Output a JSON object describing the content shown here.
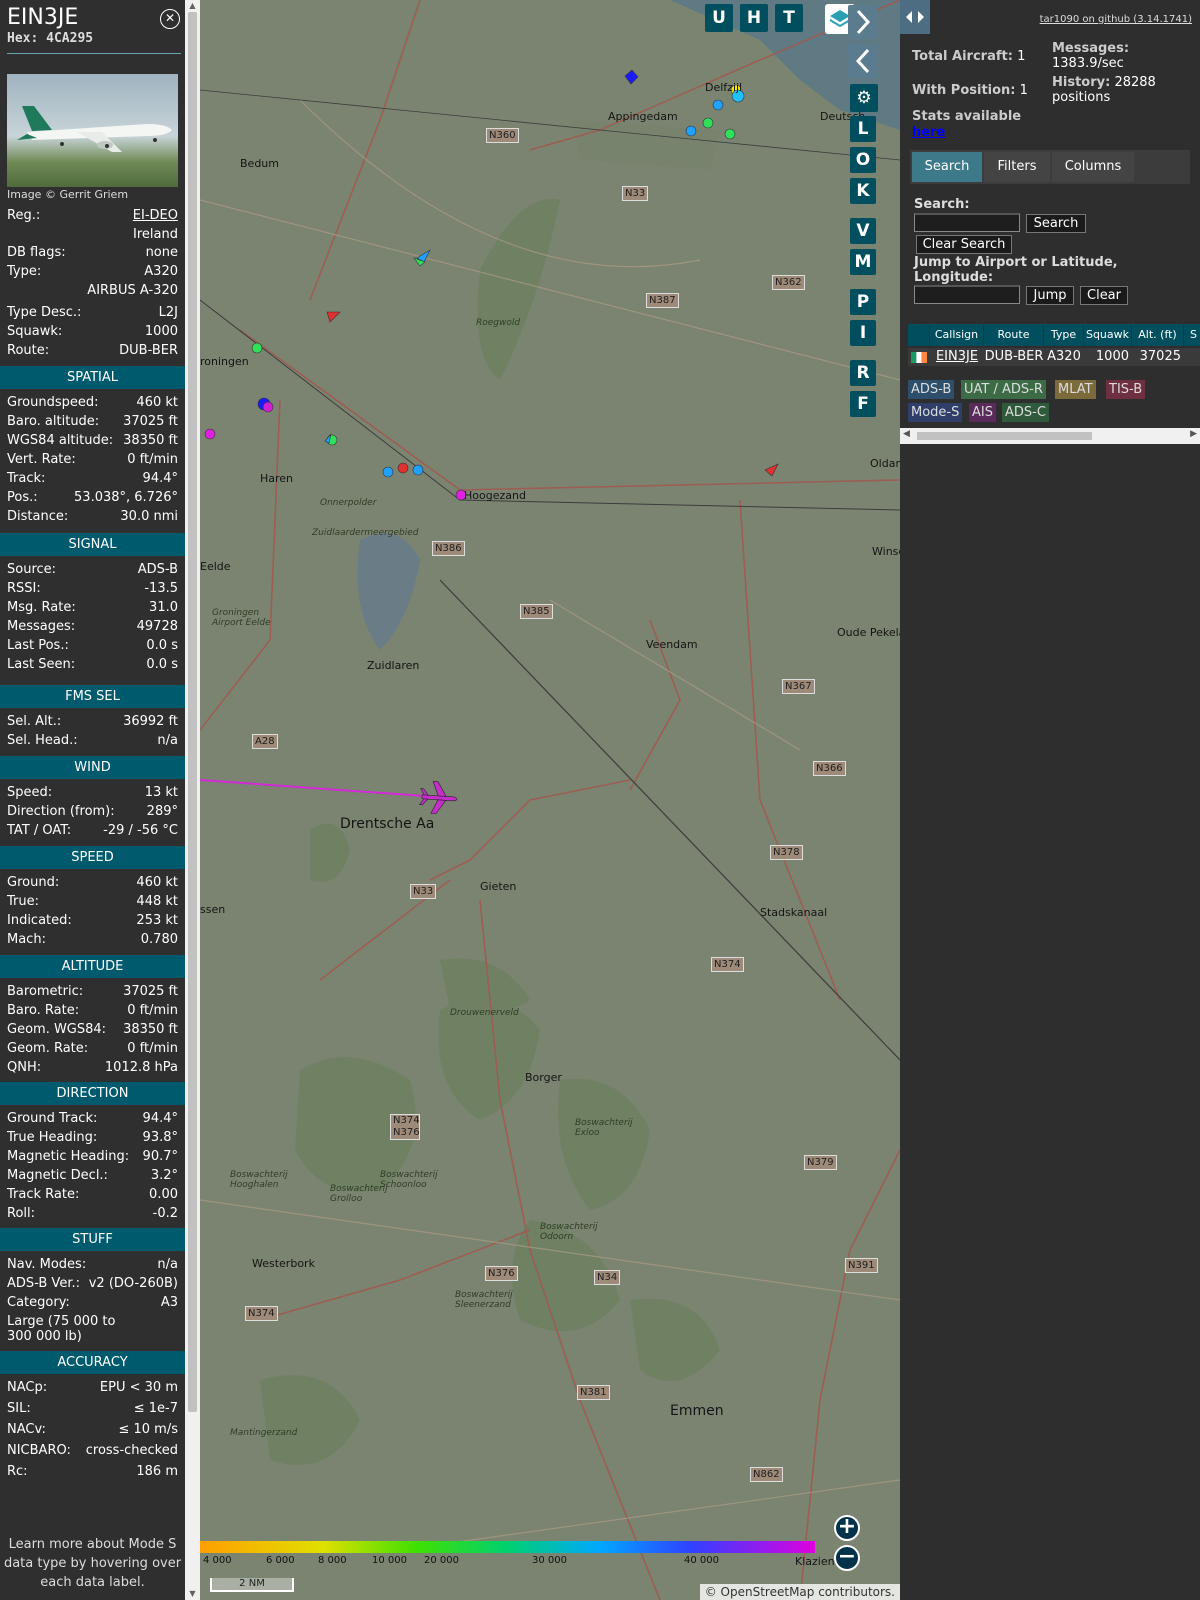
{
  "sidebar": {
    "callsign": "EIN3JE",
    "hex": "Hex: 4CA295",
    "close_icon": "close-circle-icon",
    "credit": "Image © Gerrit Griem",
    "info": [
      {
        "k": "Reg.:",
        "v": "EI-DEO",
        "link": true
      },
      {
        "k": "",
        "v": "Ireland"
      },
      {
        "k": "DB flags:",
        "v": "none"
      },
      {
        "k": "Type:",
        "v": "A320"
      },
      {
        "k": "",
        "v": "AIRBUS A-320"
      },
      {
        "k": "Type Desc.:",
        "v": "L2J"
      },
      {
        "k": "Squawk:",
        "v": "1000"
      },
      {
        "k": "Route:",
        "v": "DUB-BER"
      }
    ],
    "sections": [
      {
        "title": "SPATIAL",
        "rows": [
          {
            "k": "Groundspeed:",
            "v": "460 kt"
          },
          {
            "k": "Baro. altitude:",
            "v": "37025 ft"
          },
          {
            "k": "WGS84 altitude:",
            "v": "38350 ft"
          },
          {
            "k": "Vert. Rate:",
            "v": "0 ft/min"
          },
          {
            "k": "Track:",
            "v": "94.4°"
          },
          {
            "k": "Pos.:",
            "v": "53.038°, 6.726°"
          },
          {
            "k": "Distance:",
            "v": "30.0 nmi"
          }
        ]
      },
      {
        "title": "SIGNAL",
        "rows": [
          {
            "k": "Source:",
            "v": "ADS-B"
          },
          {
            "k": "RSSI:",
            "v": "-13.5"
          },
          {
            "k": "Msg. Rate:",
            "v": "31.0"
          },
          {
            "k": "Messages:",
            "v": "49728"
          },
          {
            "k": "Last Pos.:",
            "v": "0.0 s"
          },
          {
            "k": "Last Seen:",
            "v": "0.0 s"
          }
        ]
      },
      {
        "title": "FMS SEL",
        "rows": [
          {
            "k": "Sel. Alt.:",
            "v": "36992 ft"
          },
          {
            "k": "Sel. Head.:",
            "v": "n/a"
          }
        ]
      },
      {
        "title": "WIND",
        "rows": [
          {
            "k": "Speed:",
            "v": "13 kt"
          },
          {
            "k": "Direction (from):",
            "v": "289°"
          },
          {
            "k": "TAT / OAT:",
            "v": "-29 / -56 °C"
          }
        ]
      },
      {
        "title": "SPEED",
        "rows": [
          {
            "k": "Ground:",
            "v": "460 kt"
          },
          {
            "k": "True:",
            "v": "448 kt"
          },
          {
            "k": "Indicated:",
            "v": "253 kt"
          },
          {
            "k": "Mach:",
            "v": "0.780"
          }
        ]
      },
      {
        "title": "ALTITUDE",
        "rows": [
          {
            "k": "Barometric:",
            "v": "37025 ft"
          },
          {
            "k": "Baro. Rate:",
            "v": "0 ft/min"
          },
          {
            "k": "Geom. WGS84:",
            "v": "38350 ft"
          },
          {
            "k": "Geom. Rate:",
            "v": "0 ft/min"
          },
          {
            "k": "QNH:",
            "v": "1012.8 hPa"
          }
        ]
      },
      {
        "title": "DIRECTION",
        "rows": [
          {
            "k": "Ground Track:",
            "v": "94.4°"
          },
          {
            "k": "True Heading:",
            "v": "93.8°"
          },
          {
            "k": "Magnetic Heading:",
            "v": "90.7°"
          },
          {
            "k": "Magnetic Decl.:",
            "v": "3.2°"
          },
          {
            "k": "Track Rate:",
            "v": "0.00"
          },
          {
            "k": "Roll:",
            "v": "-0.2"
          }
        ]
      },
      {
        "title": "STUFF",
        "rows": [
          {
            "k": "Nav. Modes:",
            "v": "n/a"
          },
          {
            "k": "ADS-B Ver.:",
            "v": "v2 (DO-260B)"
          },
          {
            "k": "Category:",
            "v": "A3"
          },
          {
            "k": "Large (75 000 to 300 000 lb)",
            "v": ""
          }
        ]
      },
      {
        "title": "ACCURACY",
        "rows": [
          {
            "k": "NACp:",
            "v": "EPU < 30 m"
          },
          {
            "k": "SIL:",
            "v": "≤ 1e-7"
          },
          {
            "k": "NACv:",
            "v": "≤ 10 m/s"
          },
          {
            "k": "NICBARO:",
            "v": "cross-checked"
          },
          {
            "k": "Rc:",
            "v": "186 m"
          }
        ]
      }
    ],
    "learn": "Learn more about Mode S data type by hovering over each data label."
  },
  "map": {
    "buttons_top": [
      "U",
      "H",
      "T"
    ],
    "side_buttons": [
      "L",
      "O",
      "K",
      "V",
      "M",
      "P",
      "I",
      "R",
      "F"
    ],
    "layer_icon": "layers-icon",
    "settings_icon": "gear-icon",
    "places": [
      "Delfzijl",
      "Appingedam",
      "Bedum",
      "roningen",
      "Haren",
      "Hoogezand",
      "Onnerpolder",
      "Zuidlaardermeergebied",
      "Eelde",
      "Groningen Airport Eelde",
      "Zuidlaren",
      "Veendam",
      "Oude Pekela",
      "Winsc",
      "Drentsche Aa",
      "Gieten",
      "Stadskanaal",
      "ssen",
      "Drouwenerveld",
      "Borger",
      "Boswachterij Hooghalen",
      "Boswachterij Grolloo",
      "Boswachterij Schoonloo",
      "Boswachterij Exloo",
      "Boswachterij Odoorn",
      "Westerbork",
      "Boswachterij Sleenerzand",
      "Emmen",
      "Mantingerzand",
      "Roegwold",
      "Oldam",
      "Deutsch",
      "Klazienav"
    ],
    "roads": [
      "N360",
      "N33",
      "N387",
      "N362",
      "N386",
      "N385",
      "N367",
      "N366",
      "A28",
      "N378",
      "N33",
      "N374",
      "N374 N376",
      "N379",
      "N376",
      "N34",
      "N391",
      "N374",
      "N381",
      "N862"
    ],
    "colorbar_labels": [
      "4 000",
      "6 000",
      "8 000",
      "10 000",
      "20 000",
      "30 000",
      "40 000"
    ],
    "scale": "2 NM",
    "attribution": "© OpenStreetMap contributors."
  },
  "right": {
    "github": "tar1090 on github (3.14.1741)",
    "total_label": "Total Aircraft:",
    "total": "1",
    "withpos_label": "With Position:",
    "withpos": "1",
    "stats_label": "Stats available",
    "stats_link": "here",
    "messages_label": "Messages:",
    "messages": "1383.9/sec",
    "history_label": "History:",
    "history": "28288 positions",
    "tabs": [
      "Search",
      "Filters",
      "Columns"
    ],
    "search_label": "Search:",
    "search_btn": "Search",
    "clear_search_btn": "Clear Search",
    "jump_label": "Jump to Airport or Latitude, Longitude:",
    "jump_btn": "Jump",
    "clear_btn": "Clear",
    "table": {
      "headers": [
        "",
        "Callsign",
        "Route",
        "Type",
        "Squawk",
        "Alt. (ft)",
        "S"
      ],
      "row": [
        "",
        "EIN3JE",
        "DUB-BER",
        "A320",
        "1000",
        "37025",
        ""
      ]
    },
    "chips": [
      "ADS-B",
      "UAT / ADS-R",
      "MLAT",
      "TIS-B",
      "Mode-S",
      "AIS",
      "ADS-C"
    ],
    "chip_colors": [
      "#2d4f6c",
      "#3d6b46",
      "#7a6a3c",
      "#6e2f40",
      "#2f3f6a",
      "#5a2a5a",
      "#2f5a3c"
    ]
  }
}
